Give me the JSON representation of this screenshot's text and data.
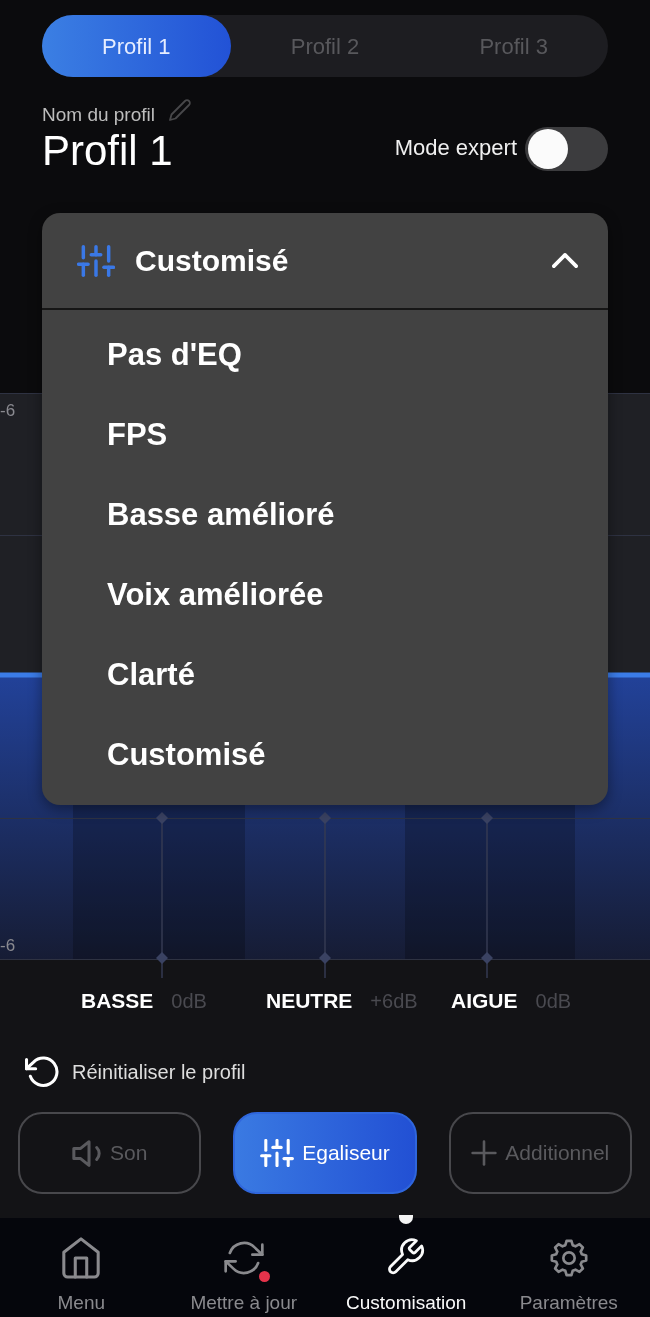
{
  "profile_tabs": [
    {
      "label": "Profil 1",
      "selected": true
    },
    {
      "label": "Profil 2",
      "selected": false
    },
    {
      "label": "Profil 3",
      "selected": false
    }
  ],
  "profile_name": {
    "label": "Nom du profil",
    "value": "Profil 1"
  },
  "expert_mode": {
    "label": "Mode expert",
    "on": false
  },
  "preset_dropdown": {
    "value": "Customisé",
    "expanded": true,
    "options": [
      "Pas d'EQ",
      "FPS",
      "Basse amélioré",
      "Voix améliorée",
      "Clarté",
      "Customisé"
    ]
  },
  "eq_graph": {
    "axis_labels": [
      "-6",
      "-6"
    ]
  },
  "bands": [
    {
      "name": "BASSE",
      "reading": "0dB"
    },
    {
      "name": "NEUTRE",
      "reading": "+6dB"
    },
    {
      "name": "AIGUE",
      "reading": "0dB"
    }
  ],
  "reset": {
    "label": "Réinitialiser le profil"
  },
  "section_buttons": [
    {
      "label": "Son",
      "selected": false
    },
    {
      "label": "Egaliseur",
      "selected": true
    },
    {
      "label": "Additionnel",
      "selected": false
    }
  ],
  "bottom_nav": [
    {
      "label": "Menu",
      "selected": false,
      "notification": false
    },
    {
      "label": "Mettre à jour",
      "selected": false,
      "notification": true
    },
    {
      "label": "Customisation",
      "selected": true,
      "notification": false
    },
    {
      "label": "Paramètres",
      "selected": false,
      "notification": false
    }
  ]
}
